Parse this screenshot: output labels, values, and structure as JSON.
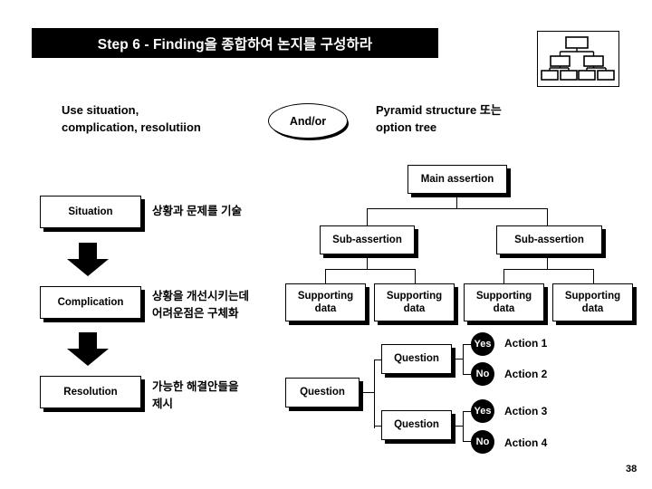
{
  "slide": {
    "title": "Step 6 - Finding을 종합하여 논지를 구성하라",
    "page_number": "38",
    "icon_name": "org-chart-icon"
  },
  "intro": {
    "left_text": "Use situation,\ncomplication, resolutiion",
    "connector_label": "And/or",
    "right_text": "Pyramid structure 또는\noption tree"
  },
  "scr_flow": {
    "steps": [
      {
        "label": "Situation",
        "note": "상황과 문제를 기술"
      },
      {
        "label": "Complication",
        "note": "상황을 개선시키는데\n어려운점은 구체화"
      },
      {
        "label": "Resolution",
        "note": "가능한 해결안들을\n제시"
      }
    ],
    "arrow_name": "down-block-arrow"
  },
  "pyramid": {
    "main": "Main assertion",
    "subs": [
      "Sub-assertion",
      "Sub-assertion"
    ],
    "supporting": [
      "Supporting\ndata",
      "Supporting\ndata",
      "Supporting\ndata",
      "Supporting\ndata"
    ]
  },
  "option_tree": {
    "root": "Question",
    "branches": [
      {
        "question": "Question",
        "outcomes": [
          {
            "answer": "Yes",
            "action": "Action 1"
          },
          {
            "answer": "No",
            "action": "Action 2"
          }
        ]
      },
      {
        "question": "Question",
        "outcomes": [
          {
            "answer": "Yes",
            "action": "Action 3"
          },
          {
            "answer": "No",
            "action": "Action 4"
          }
        ]
      }
    ]
  },
  "colors": {
    "ink": "#000000",
    "paper": "#ffffff",
    "title_bar_bg": "#000000",
    "title_bar_fg": "#ffffff"
  }
}
